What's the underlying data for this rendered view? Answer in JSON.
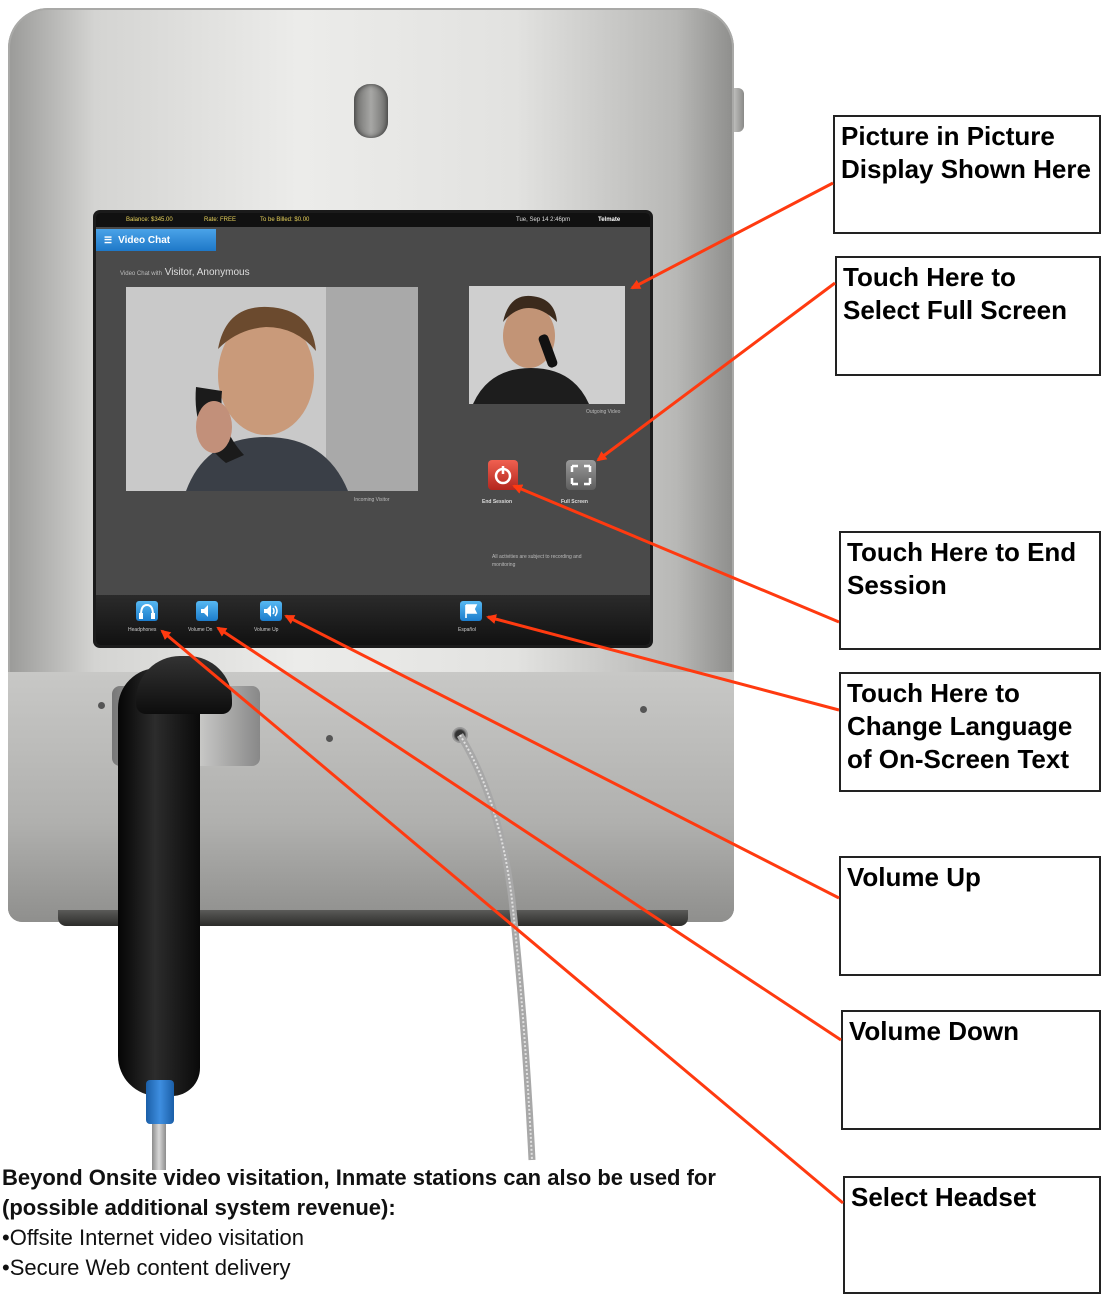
{
  "screen": {
    "status_bar": {
      "balance": "Balance: $345.00",
      "rate": "Rate: FREE",
      "to_be_billed": "To be Billed: $0.00",
      "datetime": "Tue, Sep 14  2:46pm",
      "vendor": "Telmate"
    },
    "title": "Video Chat",
    "chat_with_prefix": "Video Chat with",
    "chat_with_name": "Visitor, Anonymous",
    "main_caption": "Incoming Visitor",
    "pip_caption": "Outgoing Video",
    "end_session_label": "End Session",
    "full_screen_label": "Full Screen",
    "notice": "All activities are subject to recording and monitoring",
    "toolbar": {
      "headphones": "Headphones",
      "volume_down": "Volume Dn",
      "volume_up": "Volume Up",
      "espanol": "Español"
    }
  },
  "callouts": {
    "pip": "Picture in Picture Display Shown Here",
    "full_screen": "Touch Here to Select Full Screen",
    "end_session": "Touch Here to End Session",
    "language": "Touch Here to Change Language of On-Screen Text",
    "volume_up": "Volume Up",
    "volume_down": "Volume Down",
    "headset": "Select Headset"
  },
  "bottom": {
    "lead": "Beyond Onsite video visitation, Inmate stations can also be used for (possible additional system revenue):",
    "bullets": [
      "•Offsite Internet video visitation",
      "•Secure Web content delivery"
    ]
  },
  "colors": {
    "arrow": "#ff3a10",
    "accent_blue": "#1e78c8",
    "end_red": "#d0322a"
  }
}
